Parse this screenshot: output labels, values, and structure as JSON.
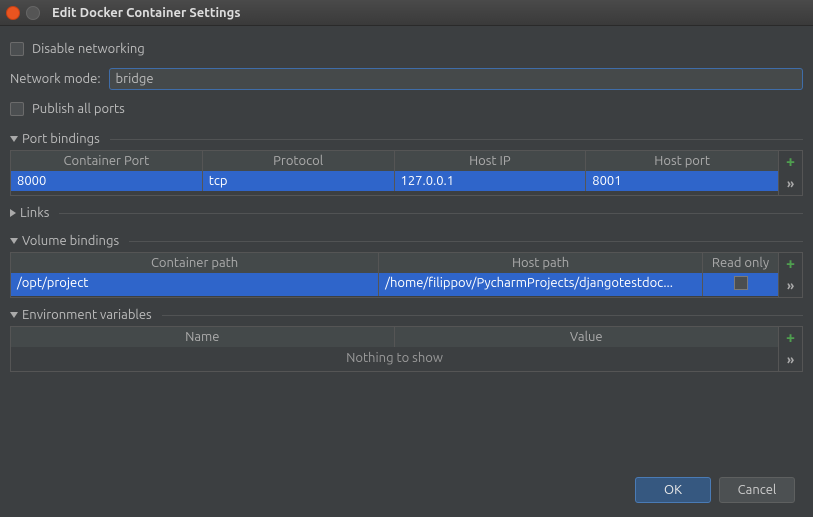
{
  "window": {
    "title": "Edit Docker Container Settings"
  },
  "options": {
    "disable_networking_label": "Disable networking",
    "network_mode_label": "Network mode:",
    "network_mode_value": "bridge",
    "publish_all_ports_label": "Publish all ports"
  },
  "port_bindings": {
    "title": "Port bindings",
    "headers": {
      "container_port": "Container Port",
      "protocol": "Protocol",
      "host_ip": "Host IP",
      "host_port": "Host port"
    },
    "rows": [
      {
        "container_port": "8000",
        "protocol": "tcp",
        "host_ip": "127.0.0.1",
        "host_port": "8001"
      }
    ]
  },
  "links": {
    "title": "Links"
  },
  "volume_bindings": {
    "title": "Volume bindings",
    "headers": {
      "container_path": "Container path",
      "host_path": "Host path",
      "read_only": "Read only"
    },
    "rows": [
      {
        "container_path": "/opt/project",
        "host_path": "/home/filippov/PycharmProjects/djangotestdoc...",
        "read_only": false
      }
    ]
  },
  "env_vars": {
    "title": "Environment variables",
    "headers": {
      "name": "Name",
      "value": "Value"
    },
    "empty_text": "Nothing to show"
  },
  "buttons": {
    "ok": "OK",
    "cancel": "Cancel"
  },
  "icons": {
    "add": "+",
    "more": "»"
  }
}
